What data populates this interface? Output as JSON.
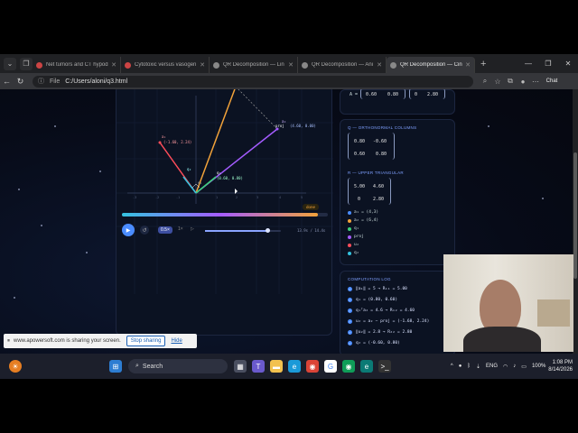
{
  "browser": {
    "tabs": [
      {
        "title": "Net tumors and CT hypod",
        "fav": "#c44"
      },
      {
        "title": "Cytotoxic versus vasogen",
        "fav": "#c44"
      },
      {
        "title": "QR Decomposition — Lin",
        "fav": "#888"
      },
      {
        "title": "QR Decomposition — Ani",
        "fav": "#888"
      },
      {
        "title": "QR Decomposition — Cin",
        "fav": "#888"
      }
    ],
    "active_tab": 4,
    "url_prefix": "File",
    "url": "C:/Users/aloni/q3.html",
    "chat_label": "Chat"
  },
  "viz": {
    "labels": {
      "a1": "a₁",
      "a1_val": "(-1.60, 2.24)",
      "a2": "a₂",
      "proj": "proj",
      "proj_val": "(4.60, 0.00)",
      "q1": "q₁",
      "q1_val": "(0.60, 0.80)",
      "e1": "e₁",
      "e2": "e₂",
      "q2": "q₂"
    },
    "badge": "done",
    "time": "13.9s / 14.4s",
    "speed": "0.5×",
    "speed2": "1×",
    "progress": 0.95,
    "timeline": 0.82
  },
  "panels": {
    "qr_top": {
      "a_symbol": "A =",
      "left": [
        "0.60",
        "0.80"
      ],
      "right": [
        "0",
        "2.80"
      ]
    },
    "q_title": "Q — ORTHONORMAL COLUMNS",
    "q": [
      [
        "0.80",
        "-0.60"
      ],
      [
        "0.60",
        "0.80"
      ]
    ],
    "r_title": "R — UPPER TRIANGULAR",
    "r": [
      [
        "5.00",
        "4.60"
      ],
      [
        "0",
        "2.80"
      ]
    ],
    "legend": [
      {
        "label": "a₁ = (4,3)",
        "color": "#4a8cff"
      },
      {
        "label": "a₂ = (6,4)",
        "color": "#f2a23a"
      },
      {
        "label": "q₁",
        "color": "#3bd17a"
      },
      {
        "label": "proj",
        "color": "#a45cff"
      },
      {
        "label": "u₂",
        "color": "#ff4d5a"
      },
      {
        "label": "q₂",
        "color": "#34c3e0"
      }
    ],
    "log_title": "COMPUTATION LOG",
    "log": [
      "‖a₁‖ = 5 → R₁₁ = 5.00",
      "q₁ = (0.80, 0.60)",
      "q₁ᵀa₂ = 4.6 → R₁₂ = 4.60",
      "u₂ = a₂ − proj = (-1.68, 2.24)",
      "‖u₂‖ = 2.8 → R₂₂ = 2.80",
      "q₂ = (-0.60, 0.80)"
    ]
  },
  "share": {
    "text": "www.apowersoft.com is sharing your screen.",
    "stop": "Stop sharing",
    "hide": "Hide"
  },
  "taskbar": {
    "search": "Search",
    "lang": "ENG",
    "battery": "100%",
    "time": "1:08 PM",
    "date": "8/14/2026"
  },
  "colors": {
    "a1": "#ff4d5a",
    "a2": "#f2a23a",
    "proj": "#a45cff",
    "q1": "#3bd17a",
    "q2": "#34c3e0"
  }
}
